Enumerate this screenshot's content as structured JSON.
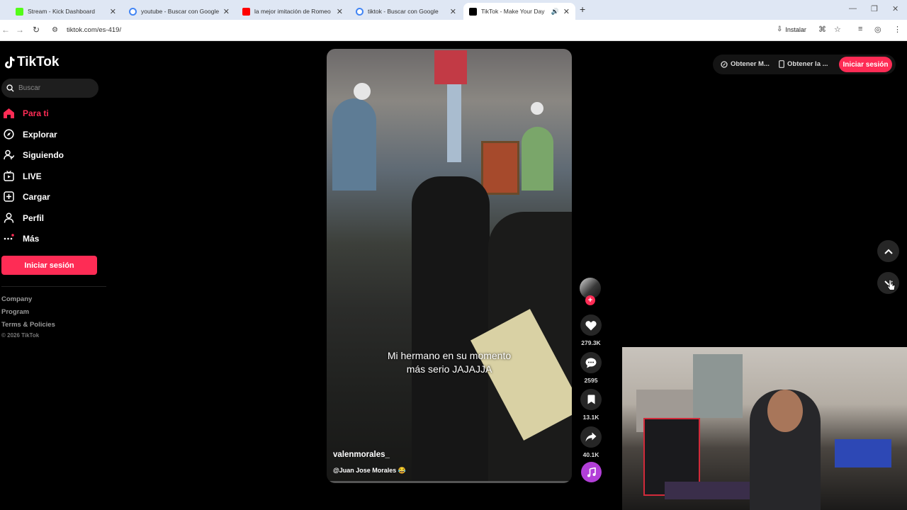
{
  "browser": {
    "tabs": [
      {
        "title": "Stream - Kick Dashboard",
        "favicon_color": "#53fc18"
      },
      {
        "title": "youtube - Buscar con Google",
        "favicon_color": "#4285f4"
      },
      {
        "title": "la mejor imitación de Romeo sa",
        "favicon_color": "#ff0000"
      },
      {
        "title": "tiktok - Buscar con Google",
        "favicon_color": "#4285f4"
      },
      {
        "title": "TikTok - Make Your Day",
        "favicon_color": "#000000"
      }
    ],
    "url": "tiktok.com/es-419/",
    "install_label": "Instalar"
  },
  "sidebar": {
    "logo_text": "TikTok",
    "search_placeholder": "Buscar",
    "items": [
      {
        "label": "Para ti",
        "icon": "home-icon",
        "active": true
      },
      {
        "label": "Explorar",
        "icon": "compass-icon"
      },
      {
        "label": "Siguiendo",
        "icon": "following-icon"
      },
      {
        "label": "LIVE",
        "icon": "live-icon"
      },
      {
        "label": "Cargar",
        "icon": "upload-icon"
      },
      {
        "label": "Perfil",
        "icon": "profile-icon"
      },
      {
        "label": "Más",
        "icon": "more-icon"
      }
    ],
    "login_label": "Iniciar sesión",
    "footer": [
      "Company",
      "Program",
      "Terms & Policies"
    ],
    "copyright": "© 2026 TikTok"
  },
  "video": {
    "caption_line1": "Mi hermano en su momento",
    "caption_line2": "más serio JAJAJJA",
    "username": "valenmorales_",
    "description": "@Juan Jose Morales 😂"
  },
  "actions": {
    "likes": "279.3K",
    "comments": "2595",
    "saves": "13.1K",
    "shares": "40.1K"
  },
  "topbar": {
    "get_coins": "Obtener M...",
    "get_app": "Obtener la ...",
    "login_label": "Iniciar sesión"
  },
  "colors": {
    "accent": "#fe2c55",
    "background": "#000000"
  }
}
